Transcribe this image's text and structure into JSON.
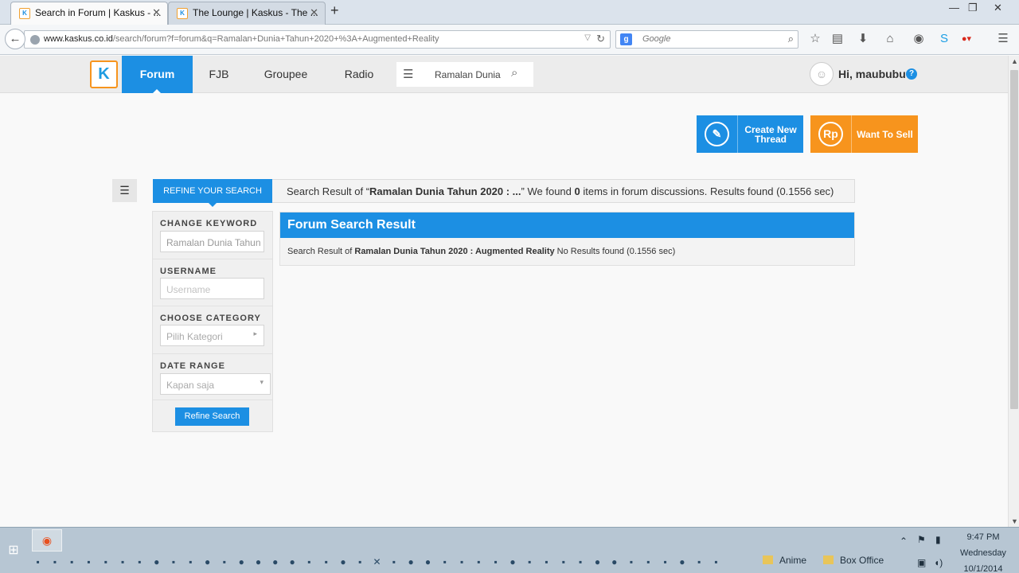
{
  "browser": {
    "tabs": [
      {
        "title": "Search in Forum | Kaskus - ...",
        "active": true
      },
      {
        "title": "The Lounge | Kaskus - The ...",
        "active": false
      }
    ],
    "new_tab_glyph": "+",
    "url_host": "www.kaskus.co.id",
    "url_path": "/search/forum?f=forum&q=Ramalan+Dunia+Tahun+2020+%3A+Augmented+Reality",
    "search_engine_placeholder": "Google",
    "toolbar_icons": [
      "bookmark-star-icon",
      "reading-list-icon",
      "download-icon",
      "home-icon",
      "pocket-icon",
      "skype-icon",
      "adblock-icon",
      "hamburger-menu-icon"
    ]
  },
  "site": {
    "logo_letter": "K",
    "nav": [
      {
        "label": "Forum",
        "active": true
      },
      {
        "label": "FJB",
        "active": false
      },
      {
        "label": "Groupee",
        "active": false
      },
      {
        "label": "Radio",
        "active": false
      }
    ],
    "search_query": "Ramalan Dunia",
    "greeting": "Hi, maububu",
    "help_glyph": "?"
  },
  "actions": {
    "create_line1": "Create New",
    "create_line2": "Thread",
    "sell_icon_text": "Rp",
    "sell_label": "Want To Sell"
  },
  "search": {
    "refine_tab": "REFINE YOUR SEARCH",
    "summary_prefix": "Search Result of “",
    "summary_query": "Ramalan Dunia Tahun 2020 : ...",
    "summary_middle": "” We found ",
    "summary_count": "0",
    "summary_suffix": " items in forum discussions. Results found (0.1556 sec)"
  },
  "refine": {
    "keyword_title": "CHANGE KEYWORD",
    "keyword_value": "Ramalan Dunia Tahun",
    "username_title": "USERNAME",
    "username_placeholder": "Username",
    "category_title": "CHOOSE CATEGORY",
    "category_placeholder": "Pilih Kategori",
    "date_title": "DATE RANGE",
    "date_value": "Kapan saja",
    "button": "Refine Search"
  },
  "results": {
    "heading": "Forum Search Result",
    "body_prefix": "Search Result of ",
    "body_query": "Ramalan Dunia Tahun 2020 : Augmented Reality",
    "body_suffix": " No Results found (0.1556 sec)"
  },
  "taskbar": {
    "folders": [
      "Anime",
      "Box Office"
    ],
    "time": "9:47 PM",
    "day": "Wednesday",
    "date": "10/1/2014"
  },
  "colors": {
    "kaskus_blue": "#1c8fe3",
    "kaskus_orange": "#f7941d"
  }
}
